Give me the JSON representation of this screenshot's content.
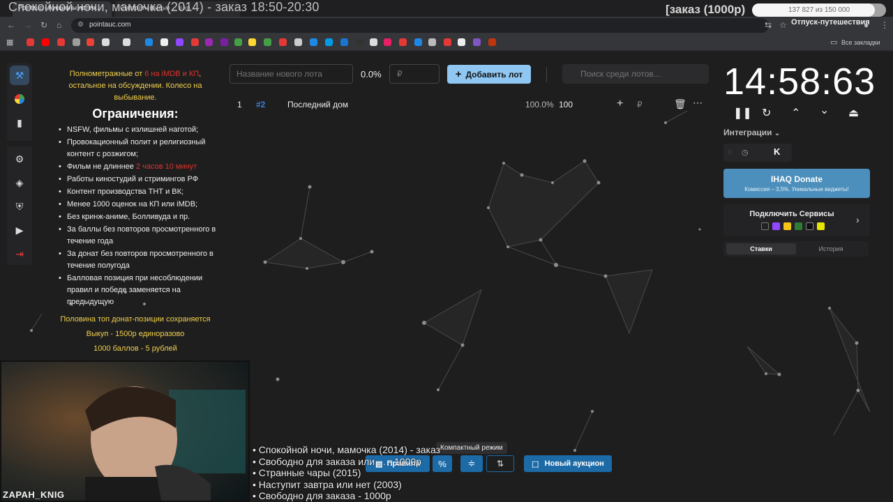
{
  "overlay": {
    "stream_title": "Спокойной ночи, мамочка (2014) - заказ 18:50-20:30",
    "order_price": "[заказ (1000р)",
    "progress_text": "137 827 из 150 000",
    "progress_fraction": 0.919,
    "vacation_note": "Отпуск-путешествия"
  },
  "browser": {
    "tabs": [
      "Pointauc - Аукционы лотер...",
      "Смотреть фильм ... в хо..."
    ],
    "url": "pointauc.com",
    "all_bookmarks": "Все закладки"
  },
  "rules": {
    "intro_before": "Полнометражные от ",
    "intro_red": "6 на iMDB и КП",
    "intro_after": ", остальное на обсуждении. Колесо на выбывание.",
    "title": "Ограничения:",
    "items": [
      "NSFW, фильмы с излишней наготой;",
      "Провокационный полит и религиозный контент с розжигом;",
      "Работы киностудий и стримингов РФ",
      "Контент производства ТНТ и ВК;",
      "Менее 1000 оценок на КП или iMDB;",
      "Без кринж-аниме, Болливуда и пр.",
      "За баллы без повторов просмотренного в течение года",
      "За донат без повторов просмотренного в течение полугода",
      "Балловая позиция при несоблюдении правил и победе заменяется на предыдущую"
    ],
    "length_item_before": "Фильм не длиннее ",
    "length_item_red": "2 часов 10 минут",
    "footer": [
      "Половина топ донат-позиции сохраняется",
      "Выкуп - 1500р единоразово",
      "1000 баллов - 5 рублей"
    ]
  },
  "lot_form": {
    "name_placeholder": "Название нового лота",
    "percent": "0.0%",
    "amount_placeholder": "₽",
    "add_label": "Добавить лот",
    "search_placeholder": "Поиск среди лотов..."
  },
  "lots": [
    {
      "index": "1",
      "id": "#2",
      "title": "Последний дом",
      "percent": "100.0%",
      "amount": "100",
      "currency": "₽"
    }
  ],
  "timer": {
    "value": "14:58:63"
  },
  "integrations": {
    "label": "Интеграции",
    "donate_title": "IHAQ Donate",
    "donate_sub": "Комиссия – 3,5%. Уникальные виджеты!",
    "services_title": "Подключить Сервисы",
    "tab_stakes": "Ставки",
    "tab_history": "История"
  },
  "toolbar": {
    "rules_label": "Правила",
    "compact_tooltip": "Компактный режим",
    "new_auction_label": "Новый аукцион"
  },
  "queue": [
    "• Спокойной ночи, мамочка (2014) - заказ",
    "• Свободно для заказа или ... - 1000р",
    "• Странные чары (2015)",
    "• Наступит завтра или нет (2003)",
    "• Свободно для заказа - 1000р"
  ],
  "webcam": {
    "name": "ZAPAH_KNIG"
  },
  "colors": {
    "accent": "#1c6aa6",
    "add_button": "#8fc7f2",
    "highlight_yellow": "#f2d04b",
    "highlight_red": "#e0342b",
    "donate_bg": "#4c8fbc"
  }
}
